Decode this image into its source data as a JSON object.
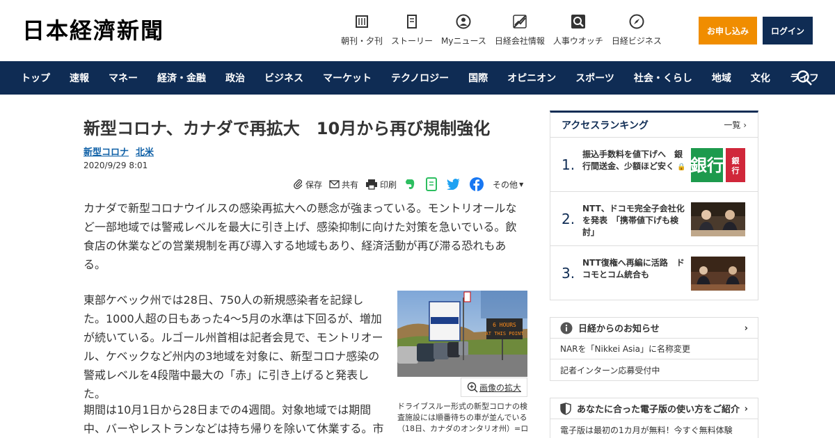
{
  "header": {
    "logo": "日本経濟新聞",
    "nav": [
      {
        "label": "朝刊・夕刊",
        "icon": "newspaper-icon"
      },
      {
        "label": "ストーリー",
        "icon": "book-icon"
      },
      {
        "label": "Myニュース",
        "icon": "user-icon"
      },
      {
        "label": "日経会社情報",
        "icon": "chart-icon"
      },
      {
        "label": "人事ウオッチ",
        "icon": "search-icon"
      },
      {
        "label": "日経ビジネス",
        "icon": "compass-icon"
      }
    ],
    "subscribe": "お申し込み",
    "login": "ログイン"
  },
  "main_nav": [
    "トップ",
    "速報",
    "マネー",
    "経済・金融",
    "政治",
    "ビジネス",
    "マーケット",
    "テクノロジー",
    "国際",
    "オピニオン",
    "スポーツ",
    "社会・くらし",
    "地域",
    "文化",
    "ライフ"
  ],
  "article": {
    "title": "新型コロナ、カナダで再拡大　10月から再び規制強化",
    "tags": [
      "新型コロナ",
      "北米"
    ],
    "date": "2020/9/29 8:01",
    "share": {
      "save": "保存",
      "share": "共有",
      "print": "印刷",
      "more": "その他"
    },
    "paragraphs": [
      "カナダで新型コロナウイルスの感染再拡大への懸念が強まっている。モントリオールなど一部地域では警戒レベルを最大に引き上げ、感染抑制に向けた対策を急いでいる。飲食店の休業などの営業規制を再び導入する地域もあり、経済活動が再び滞る恐れもある。",
      "東部ケベック州では28日、750人の新規感染者を記録した。1000人超の日もあった4～5月の水準は下回るが、増加が続いている。ルゴール州首相は記者会見で、モントリオール、ケベックなど州内の3地域を対象に、新型コロナ感染の警戒レベルを4段階中最大の「赤」に引き上げると発表した。",
      "期間は10月1日から28日までの4週間。対象地域では期間中、バーやレストランなどは持ち帰りを除いて休業する。市"
    ],
    "photo_sign": "6 HOURS AT THIS POINT",
    "enlarge": "画像の拡大",
    "caption": "ドライブスルー形式の新型コロナの検査施設には順番待ちの車が並んでいる（18日、カナダのオンタリオ州）=ロ"
  },
  "sidebar": {
    "ranking": {
      "title": "アクセスランキング",
      "more": "一覧",
      "items": [
        {
          "rank": "1.",
          "text": "振込手数料を値下げへ　銀行間送金、少額ほど安く"
        },
        {
          "rank": "2.",
          "text": "NTT、ドコモ完全子会社化を発表　「携帯値下げも検討」"
        },
        {
          "rank": "3.",
          "text": "NTT復権へ再編に活路　ドコモとコム統合も"
        }
      ],
      "thumb1_text": "銀行"
    },
    "notice": {
      "title": "日経からのお知らせ",
      "items": [
        "NARを「Nikkei Asia」に名称変更",
        "記者インターン応募受付中"
      ]
    },
    "guide": {
      "title": "あなたに合った電子版の使い方をご紹介",
      "item": "電子版は最初の1カ月が無料！今すぐ無料体験"
    }
  }
}
